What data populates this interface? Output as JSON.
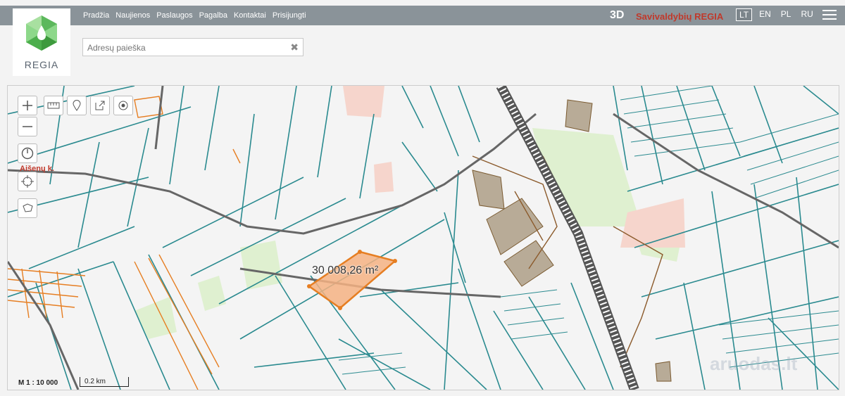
{
  "nav": {
    "items": [
      "Pradžia",
      "Naujienos",
      "Paslaugos",
      "Pagalba",
      "Kontaktai",
      "Prisijungti"
    ],
    "mode_3d": "3D",
    "brand": "Savivaldybių REGIA",
    "languages": [
      "LT",
      "EN",
      "PL",
      "RU"
    ],
    "active_language": "LT"
  },
  "logo": {
    "text": "REGIA"
  },
  "search": {
    "placeholder": "Adresų paieška"
  },
  "map": {
    "parcel_area": "30 008,26 m²",
    "village_label": "Aišenų k.",
    "scale_ratio": "M 1 : 10 000",
    "scale_bar": "0.2 km",
    "watermark": "aruodas.lt"
  },
  "colors": {
    "topbar": "#8a9399",
    "brand": "#c0392b",
    "parcel_line": "#2a8a8f",
    "selected_parcel": "#f4b183",
    "selected_outline": "#e67e22",
    "road": "#666666",
    "building": "#b8ab97"
  },
  "icons": [
    "zoom-in-icon",
    "zoom-out-icon",
    "measure-icon",
    "marker-icon",
    "share-icon",
    "locate-icon",
    "clock-icon",
    "crosshair-icon",
    "lasso-icon",
    "close-icon",
    "menu-icon"
  ]
}
